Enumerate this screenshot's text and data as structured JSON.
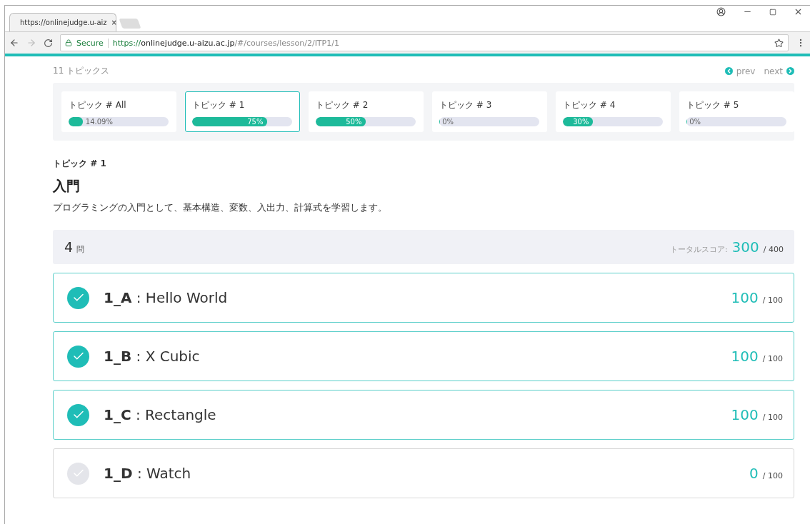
{
  "browser": {
    "tab_title": "https://onlinejudge.u-aiz",
    "tab_close": "×",
    "secure_label": "Secure",
    "url": {
      "scheme": "https://",
      "host": "onlinejudge.u-aizu.ac.jp",
      "path": "/#/courses/lesson/2/ITP1/1"
    }
  },
  "topics": {
    "count_label": "11 トピックス",
    "prev": "prev",
    "next": "next",
    "items": [
      {
        "label": "トピック # All",
        "level": 0.14,
        "reading": "14.09%",
        "selected": false
      },
      {
        "label": "トピック # 1",
        "level": 0.75,
        "reading": "75%",
        "selected": true
      },
      {
        "label": "トピック # 2",
        "level": 0.5,
        "reading": "50%",
        "selected": false
      },
      {
        "label": "トピック # 3",
        "level": 0,
        "reading": "0%",
        "selected": false
      },
      {
        "label": "トピック # 4",
        "level": 0.3,
        "reading": "30%",
        "selected": false
      },
      {
        "label": "トピック # 5",
        "level": 0,
        "reading": "0%",
        "selected": false
      }
    ]
  },
  "lesson": {
    "topic_label": "トピック # 1",
    "title": "入門",
    "description": "プログラミングの入門として、基本構造、変数、入出力、計算式を学習します。"
  },
  "summary": {
    "count": "4",
    "count_unit": "問",
    "total_label": "トータルスコア:",
    "total_score": "300",
    "total_max": "/ 400"
  },
  "problems": [
    {
      "code": "1_A",
      "title": ": Hello World",
      "score": "100",
      "max": "/ 100",
      "solved": true
    },
    {
      "code": "1_B",
      "title": ": X Cubic",
      "score": "100",
      "max": "/ 100",
      "solved": true
    },
    {
      "code": "1_C",
      "title": ": Rectangle",
      "score": "100",
      "max": "/ 100",
      "solved": true
    },
    {
      "code": "1_D",
      "title": ": Watch",
      "score": "0",
      "max": "/ 100",
      "solved": false
    }
  ]
}
